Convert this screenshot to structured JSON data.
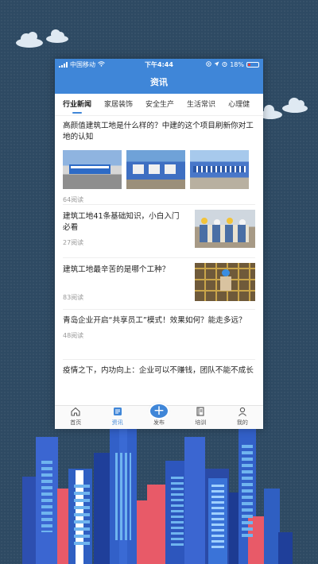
{
  "status_bar": {
    "carrier": "中国移动",
    "time": "下午4:44",
    "battery": "18%"
  },
  "header": {
    "title": "资讯"
  },
  "tabs": [
    {
      "label": "行业新闻",
      "active": true
    },
    {
      "label": "家居装饰",
      "active": false
    },
    {
      "label": "安全生产",
      "active": false
    },
    {
      "label": "生活常识",
      "active": false
    },
    {
      "label": "心理健",
      "active": false
    }
  ],
  "articles": [
    {
      "title": "高颜值建筑工地是什么样的？中建的这个项目刷新你对工地的认知",
      "reads": "64阅读",
      "images": [
        "construction-site-photo",
        "construction-site-photo",
        "construction-site-photo"
      ]
    },
    {
      "title": "建筑工地41条基础知识，小白入门必看",
      "reads": "27阅读",
      "images": [
        "workers-photo"
      ]
    },
    {
      "title": "建筑工地最辛苦的是哪个工种？",
      "reads": "83阅读",
      "images": [
        "scaffold-worker-photo"
      ]
    },
    {
      "title": "青岛企业开启“共享员工”模式！效果如何？能走多远？",
      "reads": "48阅读",
      "images": []
    },
    {
      "title": "疫情之下，内功向上：企业可以不赚钱，团队不能不成长",
      "reads": "",
      "images": []
    }
  ],
  "tab_bar": [
    {
      "label": "首页",
      "icon": "home-icon",
      "active": false
    },
    {
      "label": "资讯",
      "icon": "news-icon",
      "active": true
    },
    {
      "label": "发布",
      "icon": "plus-icon",
      "active": false
    },
    {
      "label": "培训",
      "icon": "book-icon",
      "active": false
    },
    {
      "label": "我的",
      "icon": "user-icon",
      "active": false
    }
  ],
  "colors": {
    "brand": "#3f86d8",
    "background": "#2e4a63",
    "building_blue": "#2f5fc2",
    "building_red": "#e85a68"
  }
}
